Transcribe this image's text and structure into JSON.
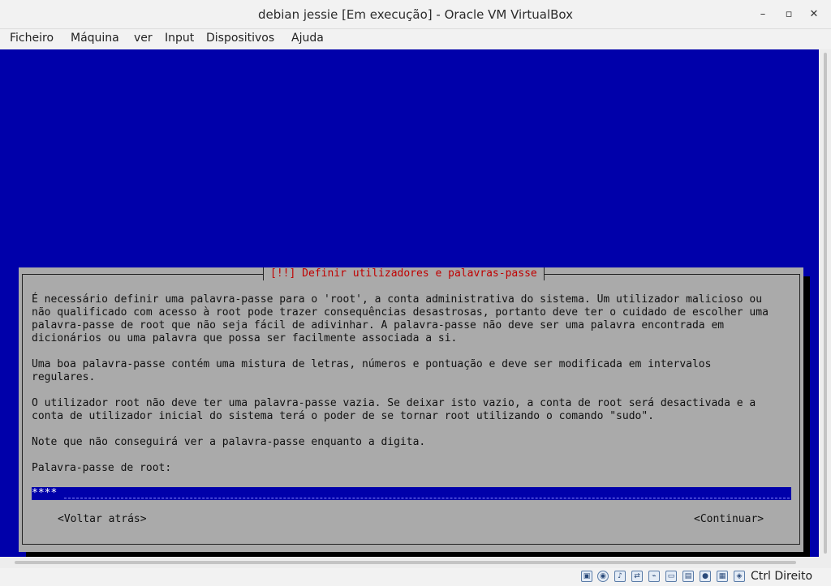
{
  "window": {
    "title": "debian jessie [Em execução] - Oracle VM VirtualBox",
    "minimize_glyph": "–",
    "maximize_glyph": "▫",
    "close_glyph": "✕"
  },
  "menu": {
    "items": [
      "Ficheiro",
      "Máquina",
      "ver",
      "Input",
      "Dispositivos",
      "Ajuda"
    ]
  },
  "installer": {
    "screen_color": "#0000aa",
    "dialog_title": "[!!] Definir utilizadores e palavras-passe",
    "title_color": "#c00000",
    "paragraphs": [
      [
        "É necessário definir uma palavra-passe para o 'root', a conta administrativa do sistema. Um utilizador malicioso ou",
        "não qualificado com acesso à root pode trazer consequências desastrosas, portanto deve ter o cuidado de escolher uma",
        "palavra-passe de root que não seja fácil de adivinhar. A palavra-passe não deve ser uma palavra encontrada em",
        "dicionários ou uma palavra que possa ser facilmente associada a si."
      ],
      [
        "Uma boa palavra-passe contém uma mistura de letras, números e pontuação e deve ser modificada em intervalos",
        "regulares."
      ],
      [
        "O utilizador root não deve ter uma palavra-passe vazia. Se deixar isto vazio, a conta de root será desactivada e a",
        "conta de utilizador inicial do sistema terá o poder de se tornar root utilizando o comando \"sudo\"."
      ],
      [
        "Note que não conseguirá ver a palavra-passe enquanto a digita."
      ]
    ],
    "password_label": "Palavra-passe de root:",
    "password_value": "****",
    "back_button": "<Voltar atrás>",
    "continue_button": "<Continuar>"
  },
  "statusbar": {
    "icons": [
      "hard-disk-icon",
      "optical-drive-icon",
      "audio-icon",
      "network-icon",
      "usb-icon",
      "shared-folders-icon",
      "display-icon",
      "video-capture-icon",
      "cpu-icon",
      "mouse-integration-icon",
      "keyboard-capture-icon"
    ],
    "host_key": "Ctrl Direito"
  }
}
